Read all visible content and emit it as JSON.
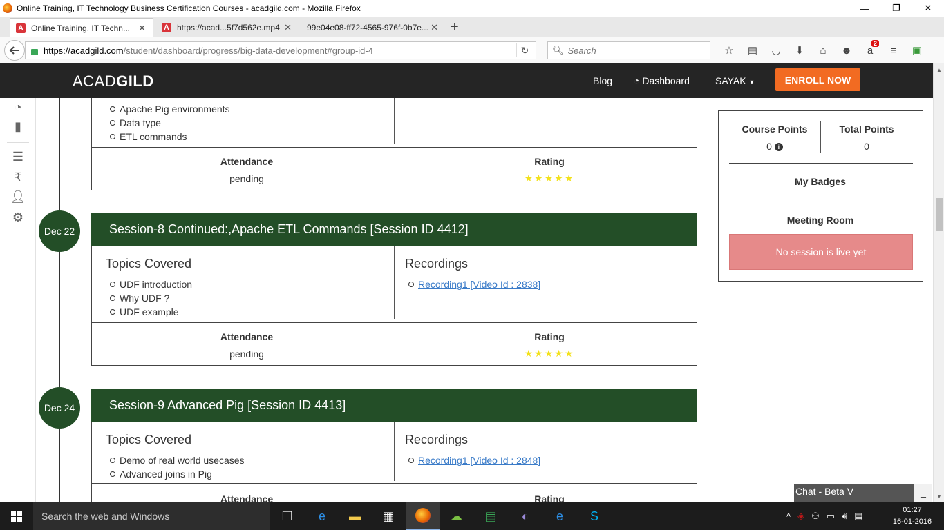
{
  "window": {
    "title": "Online Training, IT Technology Business Certification Courses - acadgild.com - Mozilla Firefox",
    "minimize": "—",
    "maximize": "❐",
    "close": "✕"
  },
  "tabs": [
    {
      "label": "Online Training, IT Techn...",
      "favicon": "A"
    },
    {
      "label": "https://acad...5f7d562e.mp4",
      "favicon": "A"
    },
    {
      "label": "99e04e08-ff72-4565-976f-0b7e...",
      "favicon": ""
    }
  ],
  "tab_close": "✕",
  "new_tab": "+",
  "nav": {
    "url_host": "https://acadgild.com",
    "url_path": "/student/dashboard/progress/big-data-development#group-id-4",
    "search_placeholder": "Search",
    "addon_badge": "2"
  },
  "site": {
    "logo_light": "ACAD",
    "logo_bold": "GILD",
    "blog": "Blog",
    "dashboard": "Dashboard",
    "user": "SAYAK",
    "enroll": "ENROLL NOW"
  },
  "sessions_top": {
    "topics": [
      "Apache Pig environments",
      "Data type",
      "ETL commands"
    ],
    "attendance_label": "Attendance",
    "attendance_value": "pending",
    "rating_label": "Rating",
    "rating_stars": "★★★★★"
  },
  "sessions": [
    {
      "date": "Dec 22",
      "title": "Session-8 Continued:,Apache ETL Commands [Session ID 4412]",
      "topics_title": "Topics Covered",
      "topics": [
        "UDF introduction",
        "Why UDF ?",
        "UDF example"
      ],
      "recordings_title": "Recordings",
      "recordings": [
        "Recording1 [Video Id : 2838]"
      ],
      "attendance_label": "Attendance",
      "attendance_value": "pending",
      "rating_label": "Rating",
      "rating_stars": "★★★★★"
    },
    {
      "date": "Dec 24",
      "title": "Session-9 Advanced Pig [Session ID 4413]",
      "topics_title": "Topics Covered",
      "topics": [
        "Demo of real world usecases",
        "Advanced joins in Pig"
      ],
      "recordings_title": "Recordings",
      "recordings": [
        "Recording1 [Video Id : 2848]"
      ],
      "attendance_label": "Attendance",
      "rating_label": "Rating"
    }
  ],
  "points": {
    "course_points_label": "Course Points",
    "course_points_value": "0",
    "total_points_label": "Total Points",
    "total_points_value": "0",
    "badges_label": "My Badges",
    "meeting_label": "Meeting Room",
    "no_session": "No session is live yet"
  },
  "chat": {
    "label": "Chat - Beta V",
    "minimize": "_"
  },
  "taskbar": {
    "search": "Search the web and Windows",
    "time": "01:27",
    "date": "16-01-2016"
  },
  "colors": {
    "session_header": "#234e27",
    "enroll": "#f26b22",
    "no_session": "#e68a8a",
    "stars": "#f3e11b"
  }
}
